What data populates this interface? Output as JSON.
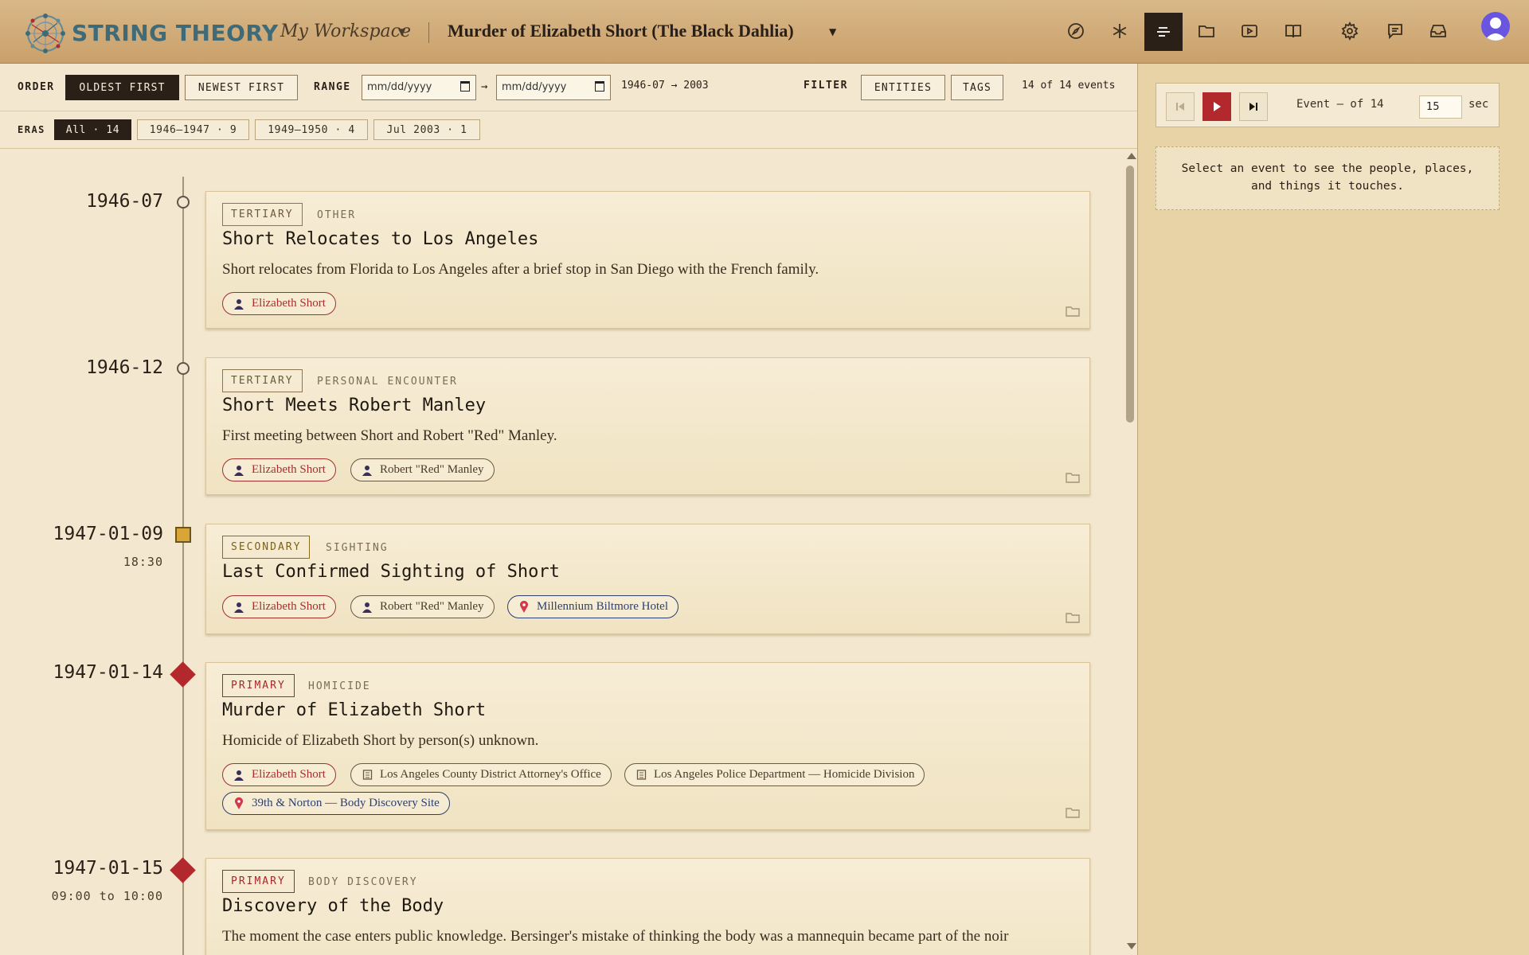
{
  "app": {
    "brand": "STRING THEORY",
    "workspace": "My Workspace",
    "case_title": "Murder of Elizabeth Short (The Black Dahlia)"
  },
  "nav_icons": [
    "compass-icon",
    "asterisk-icon",
    "timeline-icon",
    "folder-icon",
    "play-icon",
    "book-icon",
    "gear-icon",
    "chat-icon",
    "inbox-icon",
    "avatar-icon"
  ],
  "toolbar": {
    "order_label": "ORDER",
    "oldest_label": "OLDEST FIRST",
    "newest_label": "NEWEST FIRST",
    "range_label": "RANGE",
    "range_start_placeholder": "mm/dd/yyyy",
    "range_end_placeholder": "mm/dd/yyyy",
    "range_arrow": "→",
    "range_summary": "1946-07 → 2003",
    "filter_label": "FILTER",
    "entities_label": "ENTITIES",
    "tags_label": "TAGS",
    "event_count": "14 of 14 events"
  },
  "eras": {
    "label": "ERAS",
    "items": [
      "All · 14",
      "1946–1947 · 9",
      "1949–1950 · 4",
      "Jul 2003 · 1"
    ]
  },
  "colors": {
    "primary": "#b3282c",
    "secondary": "#d9a636",
    "tertiary": "#5f5648",
    "accent_dark": "#2b2018"
  },
  "events": [
    {
      "date": "1946-07",
      "time": "",
      "tier": "TERTIARY",
      "type": "OTHER",
      "title": "Short Relocates to Los Angeles",
      "description": "Short relocates from Florida to Los Angeles after a brief stop in San Diego with the French family.",
      "chips": [
        {
          "kind": "person",
          "label": "Elizabeth Short"
        }
      ]
    },
    {
      "date": "1946-12",
      "time": "",
      "tier": "TERTIARY",
      "type": "PERSONAL ENCOUNTER",
      "title": "Short Meets Robert Manley",
      "description": "First meeting between Short and Robert \"Red\" Manley.",
      "chips": [
        {
          "kind": "person",
          "label": "Elizabeth Short"
        },
        {
          "kind": "person",
          "label": "Robert \"Red\" Manley"
        }
      ]
    },
    {
      "date": "1947-01-09",
      "time": "18:30",
      "tier": "SECONDARY",
      "type": "SIGHTING",
      "title": "Last Confirmed Sighting of Short",
      "description": "",
      "chips": [
        {
          "kind": "person",
          "label": "Elizabeth Short"
        },
        {
          "kind": "person",
          "label": "Robert \"Red\" Manley"
        },
        {
          "kind": "place",
          "label": "Millennium Biltmore Hotel"
        }
      ]
    },
    {
      "date": "1947-01-14",
      "time": "",
      "tier": "PRIMARY",
      "type": "HOMICIDE",
      "title": "Murder of Elizabeth Short",
      "description": "Homicide of Elizabeth Short by person(s) unknown.",
      "chips": [
        {
          "kind": "person",
          "label": "Elizabeth Short"
        },
        {
          "kind": "org",
          "label": "Los Angeles County District Attorney's Office"
        },
        {
          "kind": "org",
          "label": "Los Angeles Police Department — Homicide Division"
        },
        {
          "kind": "place",
          "label": "39th & Norton — Body Discovery Site"
        }
      ]
    },
    {
      "date": "1947-01-15",
      "time": "09:00 to 10:00",
      "tier": "PRIMARY",
      "type": "BODY DISCOVERY",
      "title": "Discovery of the Body",
      "description": "The moment the case enters public knowledge. Bersinger's mistake of thinking the body was a mannequin became part of the noir",
      "chips": []
    }
  ],
  "player": {
    "event_of": "Event — of 14",
    "seconds": "15",
    "sec_label": "sec"
  },
  "panel_hint": "Select an event to see the people, places, and things it touches."
}
